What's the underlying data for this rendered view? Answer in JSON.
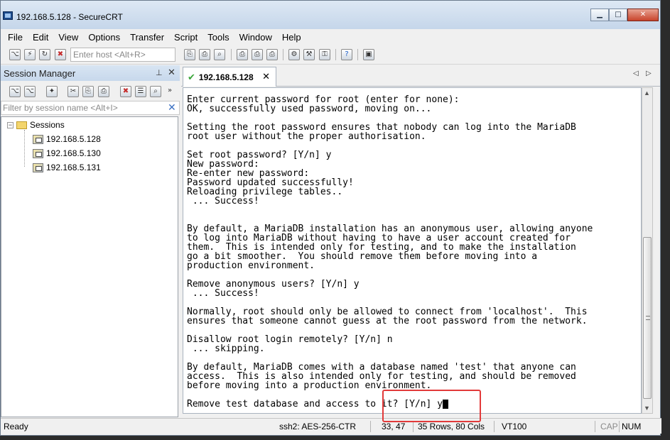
{
  "window": {
    "title": "192.168.5.128 - SecureCRT"
  },
  "menu": [
    "File",
    "Edit",
    "View",
    "Options",
    "Transfer",
    "Script",
    "Tools",
    "Window",
    "Help"
  ],
  "toolbar": {
    "quick_connect_placeholder": "Enter host <Alt+R>"
  },
  "session_manager": {
    "title": "Session Manager",
    "filter_placeholder": "Filter by session name <Alt+I>",
    "root_folder": "Sessions",
    "sessions": [
      "192.168.5.128",
      "192.168.5.130",
      "192.168.5.131"
    ]
  },
  "tab": {
    "label": "192.168.5.128"
  },
  "terminal": {
    "lines": [
      "Enter current password for root (enter for none):",
      "OK, successfully used password, moving on...",
      "",
      "Setting the root password ensures that nobody can log into the MariaDB",
      "root user without the proper authorisation.",
      "",
      "Set root password? [Y/n] y",
      "New password:",
      "Re-enter new password:",
      "Password updated successfully!",
      "Reloading privilege tables..",
      " ... Success!",
      "",
      "",
      "By default, a MariaDB installation has an anonymous user, allowing anyone",
      "to log into MariaDB without having to have a user account created for",
      "them.  This is intended only for testing, and to make the installation",
      "go a bit smoother.  You should remove them before moving into a",
      "production environment.",
      "",
      "Remove anonymous users? [Y/n] y",
      " ... Success!",
      "",
      "Normally, root should only be allowed to connect from 'localhost'.  This",
      "ensures that someone cannot guess at the root password from the network.",
      "",
      "Disallow root login remotely? [Y/n] n",
      " ... skipping.",
      "",
      "By default, MariaDB comes with a database named 'test' that anyone can",
      "access.  This is also intended only for testing, and should be removed",
      "before moving into a production environment.",
      "",
      "Remove test database and access to it? [Y/n] y"
    ]
  },
  "status": {
    "ready": "Ready",
    "protocol": "ssh2: AES-256-CTR",
    "cursor_pos": "33,  47",
    "size": "35 Rows, 80 Cols",
    "emulation": "VT100",
    "cap": "CAP",
    "num": "NUM"
  },
  "colors": {
    "highlight_border": "#e23a3a",
    "tab_check": "#3aa63a"
  }
}
